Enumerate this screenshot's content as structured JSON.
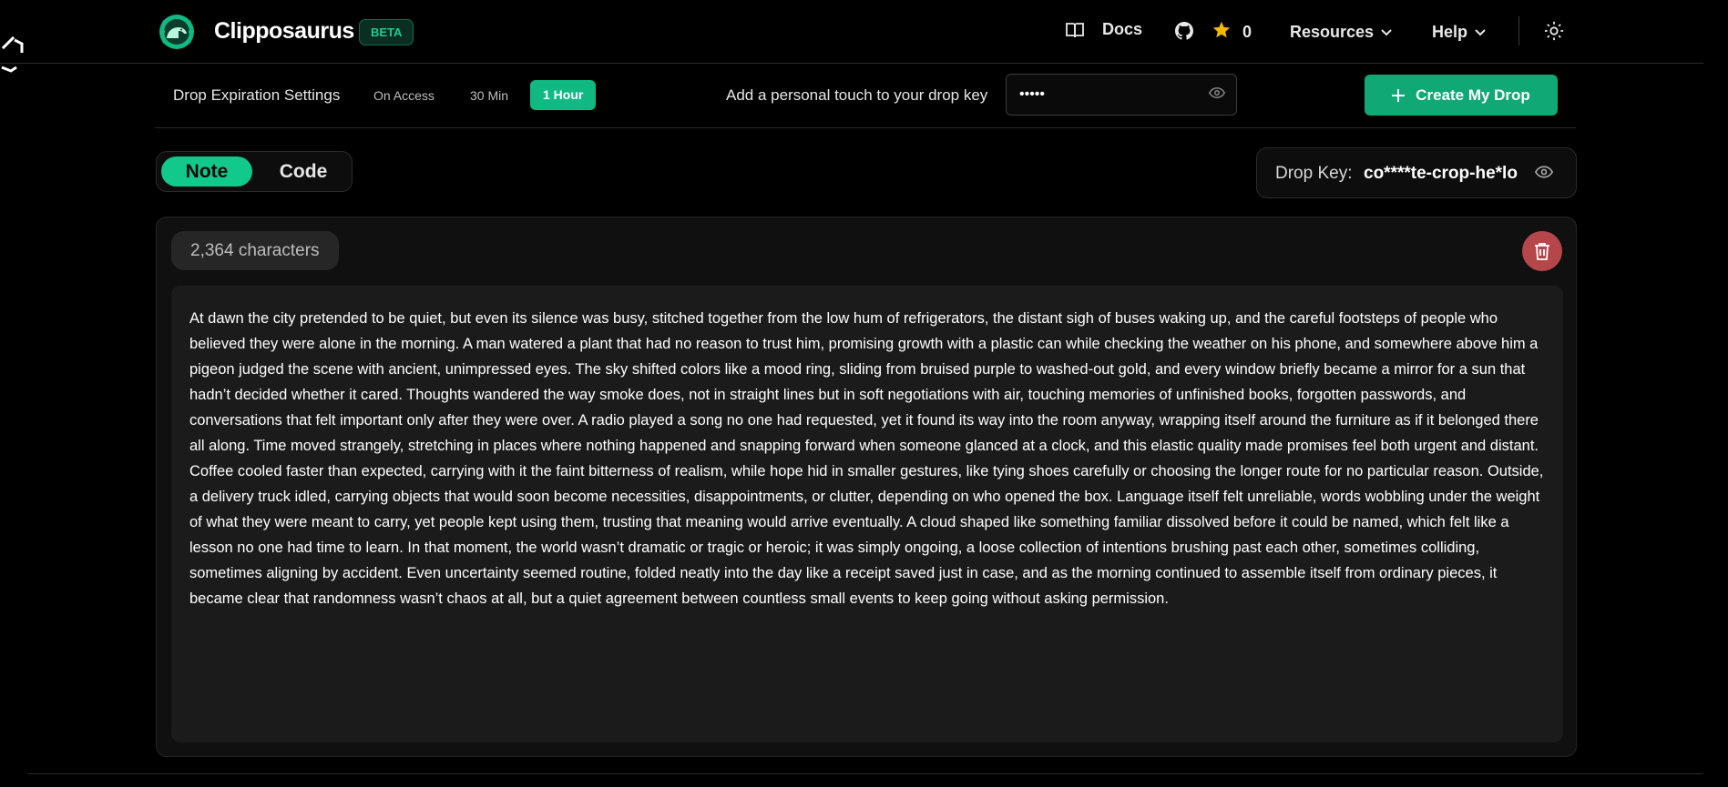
{
  "header": {
    "brand": "Clipposaurus",
    "badge": "BETA",
    "docs_label": "Docs",
    "star_count": "0",
    "resources_label": "Resources",
    "help_label": "Help",
    "icons": [
      "dino-logo-icon",
      "book-icon",
      "github-icon",
      "star-icon",
      "chevron-down-icon",
      "sun-icon"
    ]
  },
  "settings": {
    "expiration_label": "Drop Expiration Settings",
    "options": [
      "On Access",
      "30 Min",
      "1 Hour"
    ],
    "selected_option": "1 Hour",
    "personal_touch_label": "Add a personal touch to your drop key",
    "key_value": "•••••",
    "create_button": "Create My Drop"
  },
  "tabs": {
    "note": "Note",
    "code": "Code",
    "active": "Note"
  },
  "drop_key": {
    "label": "Drop Key:",
    "value": "co****te-crop-he*lo"
  },
  "editor": {
    "char_count": "2,364 characters",
    "content": "At dawn the city pretended to be quiet, but even its silence was busy, stitched together from the low hum of refrigerators, the distant sigh of buses waking up, and the careful footsteps of people who believed they were alone in the morning. A man watered a plant that had no reason to trust him, promising growth with a plastic can while checking the weather on his phone, and somewhere above him a pigeon judged the scene with ancient, unimpressed eyes. The sky shifted colors like a mood ring, sliding from bruised purple to washed-out gold, and every window briefly became a mirror for a sun that hadn’t decided whether it cared. Thoughts wandered the way smoke does, not in straight lines but in soft negotiations with air, touching memories of unfinished books, forgotten passwords, and conversations that felt important only after they were over. A radio played a song no one had requested, yet it found its way into the room anyway, wrapping itself around the furniture as if it belonged there all along. Time moved strangely, stretching in places where nothing happened and snapping forward when someone glanced at a clock, and this elastic quality made promises feel both urgent and distant. Coffee cooled faster than expected, carrying with it the faint bitterness of realism, while hope hid in smaller gestures, like tying shoes carefully or choosing the longer route for no particular reason. Outside, a delivery truck idled, carrying objects that would soon become necessities, disappointments, or clutter, depending on who opened the box. Language itself felt unreliable, words wobbling under the weight of what they were meant to carry, yet people kept using them, trusting that meaning would arrive eventually. A cloud shaped like something familiar dissolved before it could be named, which felt like a lesson no one had time to learn. In that moment, the world wasn’t dramatic or tragic or heroic; it was simply ongoing, a loose collection of intentions brushing past each other, sometimes colliding, sometimes aligning by accident. Even uncertainty seemed routine, folded neatly into the day like a receipt saved just in case, and as the morning continued to assemble itself from ordinary pieces, it became clear that randomness wasn’t chaos at all, but a quiet agreement between countless small events to keep going without asking permission."
  },
  "colors": {
    "accent": "#10b981",
    "danger": "#b5474b",
    "background": "#000000",
    "panel": "#1b1b1c"
  }
}
